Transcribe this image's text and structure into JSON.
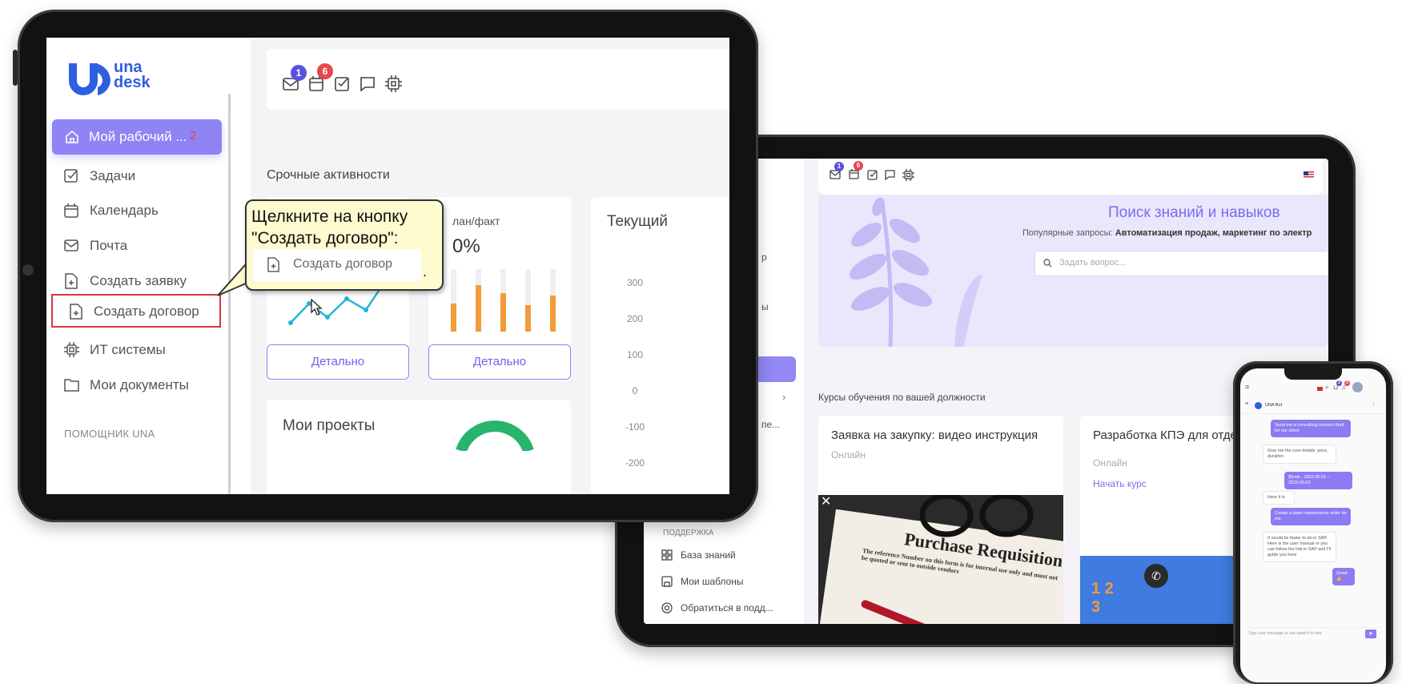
{
  "tablet_front": {
    "logo_line1": "una",
    "logo_line2": "desk",
    "toolbar": {
      "mail_badge": "1",
      "calendar_badge": "6"
    },
    "nav": [
      {
        "label": "Мой рабочий ...",
        "badge": "2",
        "icon": "home-icon",
        "active": true
      },
      {
        "label": "Задачи",
        "icon": "check-square-icon"
      },
      {
        "label": "Календарь",
        "icon": "calendar-icon"
      },
      {
        "label": "Почта",
        "icon": "mail-icon"
      },
      {
        "label": "Создать заявку",
        "icon": "file-plus-icon"
      },
      {
        "label": "Создать договор",
        "icon": "file-plus-icon",
        "highlighted": true
      },
      {
        "label": "ИТ системы",
        "icon": "cpu-icon"
      },
      {
        "label": "Мои документы",
        "icon": "folder-icon"
      }
    ],
    "section_helper": "ПОМОЩНИК UNA",
    "urgent_title": "Срочные активности",
    "card2_label": "лан/факт",
    "card2_value": "0%",
    "card3_title": "Текущий",
    "yaxis": [
      "300",
      "200",
      "100",
      "0",
      "-100",
      "-200"
    ],
    "details_button": "Детально",
    "projects_title": "Мои проекты",
    "tooltip": {
      "text_line1": "Щелкните на кнопку",
      "text_line2": "\"Создать договор\":",
      "button_label": "Создать договор",
      "dot": "."
    }
  },
  "tablet_back": {
    "toolbar": {
      "mail_badge": "1",
      "calendar_badge": "6"
    },
    "hero": {
      "title": "Поиск знаний и навыков",
      "popular_prefix": "Популярные запросы: ",
      "popular_bold": "Автоматизация продаж, маркетинг по электр",
      "search_placeholder": "Задать вопрос..."
    },
    "sidebar_fragments": [
      "р",
      "ы",
      "пе..."
    ],
    "courses_title": "Курсы обучения по вашей должности",
    "courses": [
      {
        "title": "Заявка на закупку: видео инструкция",
        "format": "Онлайн",
        "image_caption": "Purchase Requisition",
        "image_subtext": "The reference Number on this form is for internal use only and must not be quoted or sent to outside vendors"
      },
      {
        "title": "Разработка КПЭ для отде",
        "format": "Онлайн",
        "action": "Начать курс"
      }
    ],
    "support": {
      "section": "ПОДДЕРЖКА",
      "items": [
        {
          "label": "База знаний",
          "icon": "grid-icon"
        },
        {
          "label": "Мои шаблоны",
          "icon": "save-icon"
        },
        {
          "label": "Обратиться в подд...",
          "icon": "lifebuoy-icon"
        }
      ]
    }
  },
  "phone": {
    "bot_name": "UNA Bot",
    "badge_a": "2",
    "badge_b": "5",
    "messages": [
      {
        "from": "user",
        "text": "Send me a consulting contract draft for our client"
      },
      {
        "from": "bot",
        "text": "Give me the core details: price, duration"
      },
      {
        "from": "user",
        "text": "$5mln., 2022.05.01 – 2022.05.03"
      },
      {
        "from": "bot",
        "text": "Here it is"
      },
      {
        "from": "user",
        "text": "Create a plant maintenance order for me."
      },
      {
        "from": "bot",
        "text": "It would be faster to do in SAP. Here is the user manual or you can follow the link in SAP and I'll guide you here"
      },
      {
        "from": "user",
        "text": "Great 👍"
      }
    ],
    "input_placeholder": "Type your message or use speech to text"
  },
  "colors": {
    "accent": "#8b7cf3",
    "badge_red": "#e5484d",
    "badge_blue": "#5b4fe0",
    "highlight_border": "#d9363e",
    "tooltip_bg": "#fffbd0"
  }
}
